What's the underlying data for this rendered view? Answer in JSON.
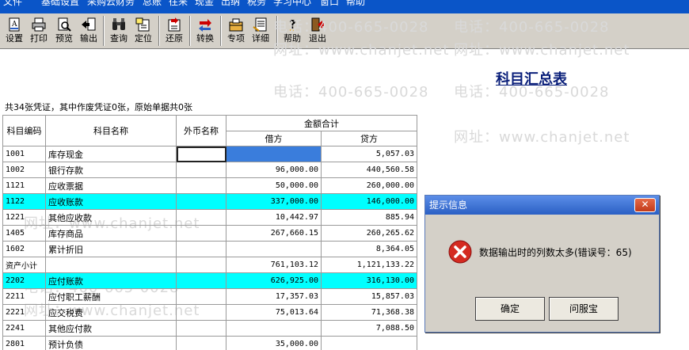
{
  "menu": [
    "文件",
    "基础设置",
    "采购云财务",
    "总账",
    "往来",
    "现金",
    "出纳",
    "税务",
    "学习中心",
    "窗口",
    "帮助"
  ],
  "toolbar": [
    {
      "label": "设置",
      "icon": "settings-icon"
    },
    {
      "label": "打印",
      "icon": "printer-icon"
    },
    {
      "label": "预览",
      "icon": "preview-icon"
    },
    {
      "label": "输出",
      "icon": "export-icon"
    },
    {
      "label": "查询",
      "icon": "binoculars-icon"
    },
    {
      "label": "定位",
      "icon": "locate-icon"
    },
    {
      "label": "还原",
      "icon": "restore-icon"
    },
    {
      "label": "转换",
      "icon": "convert-icon"
    },
    {
      "label": "专项",
      "icon": "special-icon"
    },
    {
      "label": "详细",
      "icon": "detail-icon"
    },
    {
      "label": "帮助",
      "icon": "help-icon"
    },
    {
      "label": "退出",
      "icon": "exit-icon"
    }
  ],
  "watermarks": {
    "phone": "电话：400-665-0028",
    "site": "网址：www.chanjet.net"
  },
  "report": {
    "title": "科目汇总表",
    "summary": "共34张凭证，其中作废凭证0张，原始单据共0张"
  },
  "table": {
    "headers": {
      "code": "科目编码",
      "name": "科目名称",
      "currency": "外币名称",
      "amount_total": "金额合计",
      "debit": "借方",
      "credit": "贷方"
    },
    "rows": [
      {
        "code": "1001",
        "name": "库存现金",
        "currency": "",
        "debit": "",
        "credit": "5,057.03"
      },
      {
        "code": "1002",
        "name": "银行存款",
        "currency": "",
        "debit": "96,000.00",
        "credit": "440,560.58"
      },
      {
        "code": "1121",
        "name": "应收票据",
        "currency": "",
        "debit": "50,000.00",
        "credit": "260,000.00"
      },
      {
        "code": "1122",
        "name": "应收账款",
        "currency": "",
        "debit": "337,000.00",
        "credit": "146,000.00"
      },
      {
        "code": "1221",
        "name": "其他应收款",
        "currency": "",
        "debit": "10,442.97",
        "credit": "885.94"
      },
      {
        "code": "1405",
        "name": "库存商品",
        "currency": "",
        "debit": "267,660.15",
        "credit": "260,265.62"
      },
      {
        "code": "1602",
        "name": "累计折旧",
        "currency": "",
        "debit": "",
        "credit": "8,364.05"
      },
      {
        "code": "资产小计",
        "name": "",
        "currency": "",
        "debit": "761,103.12",
        "credit": "1,121,133.22"
      },
      {
        "code": "2202",
        "name": "应付账款",
        "currency": "",
        "debit": "626,925.00",
        "credit": "316,130.00"
      },
      {
        "code": "2211",
        "name": "应付职工薪酬",
        "currency": "",
        "debit": "17,357.03",
        "credit": "15,857.03"
      },
      {
        "code": "2221",
        "name": "应交税费",
        "currency": "",
        "debit": "75,013.64",
        "credit": "71,368.38"
      },
      {
        "code": "2241",
        "name": "其他应付款",
        "currency": "",
        "debit": "",
        "credit": "7,088.50"
      },
      {
        "code": "2801",
        "name": "预计负债",
        "currency": "",
        "debit": "35,000.00",
        "credit": ""
      }
    ]
  },
  "dialog": {
    "title": "提示信息",
    "close": "✕",
    "message": "数据输出时的列数太多(错误号：65)",
    "ok_label": "确定",
    "help_label": "问服宝"
  },
  "colors": {
    "highlight_row": "#00ffff",
    "menu_bar": "#0a55c8",
    "title": "#0a1f7a"
  }
}
